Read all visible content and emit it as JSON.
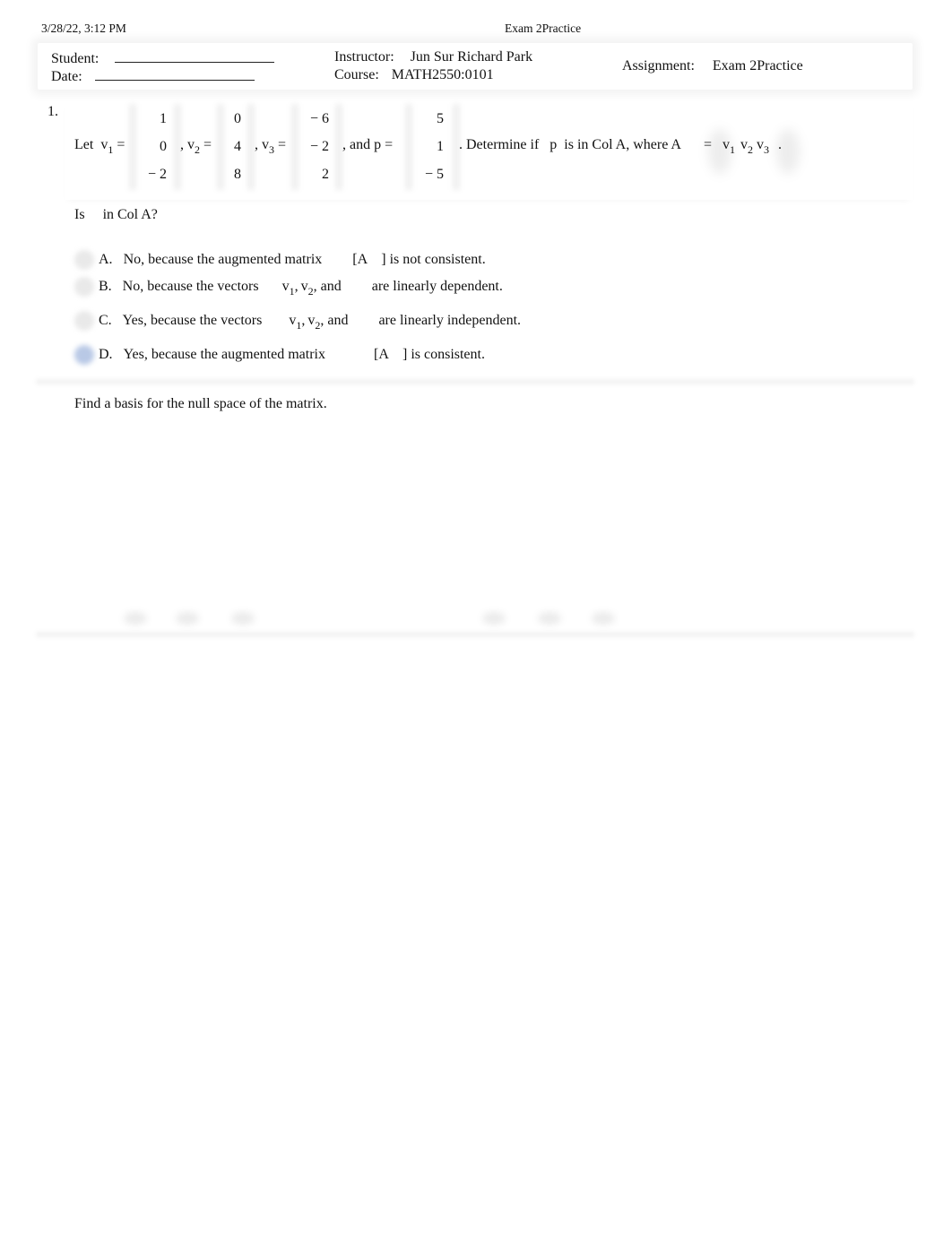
{
  "print_header": {
    "datetime": "3/28/22, 3:12 PM",
    "title": "Exam 2Practice"
  },
  "info": {
    "student_label": "Student:",
    "student_value": "",
    "date_label": "Date:",
    "date_value": "",
    "instructor_label": "Instructor:",
    "instructor_value": "Jun Sur Richard Park",
    "course_label": "Course:",
    "course_value": "MATH2550:0101",
    "assignment_label": "Assignment:",
    "assignment_value": "Exam 2Practice"
  },
  "question1": {
    "number": "1.",
    "let": "Let",
    "v1_label": "v",
    "v1_sub": "1",
    "equals": "=",
    "v1": [
      "1",
      "0",
      "− 2"
    ],
    "v2_label": ", v",
    "v2_sub": "2",
    "v2": [
      "0",
      "4",
      "8"
    ],
    "v3_label": ", v",
    "v3_sub": "3",
    "v3": [
      "− 6",
      "− 2",
      "2"
    ],
    "and_p": ", and  p =",
    "p": [
      "5",
      "1",
      "− 5"
    ],
    "determine": ". Determine if",
    "p_var": "p",
    "in_col": "is in Col A, where A",
    "a_equals": "=",
    "a_cols": [
      {
        "label": "v",
        "sub": "1"
      },
      {
        "label": "v",
        "sub": "2"
      },
      {
        "label": "v",
        "sub": "3"
      }
    ],
    "period": ".",
    "prompt_is": "Is",
    "prompt_rest": "in Col A?",
    "options": [
      {
        "letter": "A.",
        "text_a": "No, because the augmented matrix",
        "text_b": "[A",
        "text_c": "] is not consistent.",
        "selected": false
      },
      {
        "letter": "B.",
        "text_a": "No, because the vectors",
        "v1": "v",
        "s1": "1",
        "comma": ",",
        "v2": "v",
        "s2": "2",
        "and": ", and",
        "text_c": "are linearly dependent.",
        "selected": false
      },
      {
        "letter": "C.",
        "text_a": "Yes, because the vectors",
        "v1": "v",
        "s1": "1",
        "comma": ",",
        "v2": "v",
        "s2": "2",
        "and": ", and",
        "text_c": "are linearly independent.",
        "selected": false
      },
      {
        "letter": "D.",
        "text_a": "Yes, because the augmented matrix",
        "text_b": "[A",
        "text_c": "]  is consistent.",
        "selected": true
      }
    ]
  },
  "question2": {
    "prompt": "Find a basis for the null space of the matrix."
  },
  "colors": {
    "selected_radio": "#b9c9e6",
    "unselected_radio": "#e9e9e9",
    "text": "#111111"
  }
}
